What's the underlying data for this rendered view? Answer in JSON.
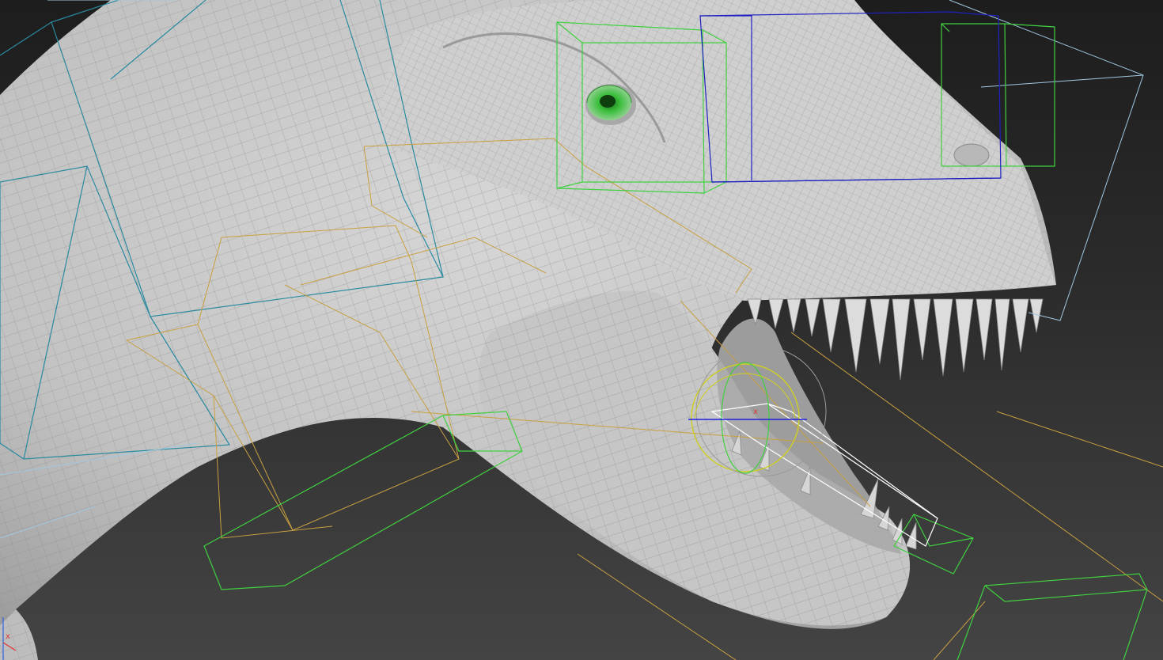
{
  "viewport": {
    "background_top": "#1d1d1d",
    "background_bottom": "#444444"
  },
  "model": {
    "skin_color": "#c9c9c9",
    "wire_color": "#8a8a8a",
    "teeth_color": "#dcdcdc"
  },
  "rig_colors": {
    "spine_bones": "#2a8aa0",
    "neck_bones": "#c9a040",
    "eye_helpers": "#40d040",
    "head_bone": "#2020c0",
    "jaw_bone": "#c9a040",
    "bounding_box": "#a0c8e0",
    "selected_bone": "#ffffff"
  },
  "gizmo": {
    "axis_label": "x",
    "x_axis_color": "#e03030",
    "y_axis_color": "#d0d020",
    "z_axis_color": "#2020e0"
  },
  "corner_axis": {
    "label": "x",
    "color": "#e03030"
  }
}
